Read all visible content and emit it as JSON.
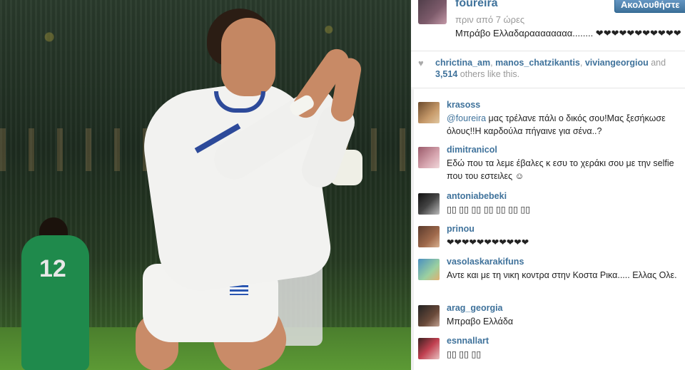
{
  "post": {
    "owner": "foureira",
    "time": "πριν από 7 ώρες",
    "follow_label": "Ακολουθήστε",
    "caption": "Μπράβο Ελλαδαραααααααα........ ❤❤❤❤❤❤❤❤❤❤❤"
  },
  "likes": {
    "users": [
      "chrictina_am",
      "manos_chatzikantis",
      "viviangeorgiou"
    ],
    "and": "and",
    "count": "3,514",
    "suffix": "others like this."
  },
  "comments": [
    {
      "user": "krasoss",
      "mention": "@foureira",
      "text": " μας τρέλανε πάλι ο δικός σου!Μας ξεσήκωσε όλους!!Η καρδούλα πήγαινε για σένα..?"
    },
    {
      "user": "dimitranicol",
      "mention": "",
      "text": "Εδώ που τα λεμε έβαλες κ εσυ το χεράκι σου με την selfie που του εστειλες ☺"
    },
    {
      "user": "antoniabebeki",
      "mention": "",
      "text": "▯▯ ▯▯ ▯▯ ▯▯ ▯▯ ▯▯ ▯▯"
    },
    {
      "user": "prinou",
      "mention": "",
      "text": "❤❤❤❤❤❤❤❤❤❤❤"
    },
    {
      "user": "vasolaskarakifuns",
      "mention": "",
      "text": "Αντε και με τη νικη κοντρα στην Κοστα Ρικα..... Ελλας Ολε."
    },
    {
      "user": "arag_georgia",
      "mention": "",
      "text": "Μπραβο Ελλάδα"
    },
    {
      "user": "esnnallart",
      "mention": "",
      "text": "▯▯ ▯▯ ▯▯"
    }
  ],
  "photo": {
    "jersey_number": "12"
  },
  "colors": {
    "link": "#3f729b",
    "muted": "#999999",
    "button": "#3f729b"
  }
}
